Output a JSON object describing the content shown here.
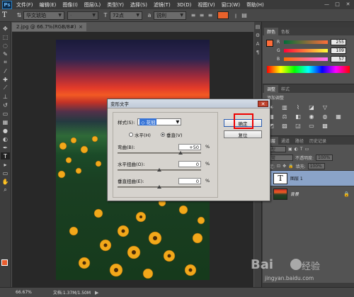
{
  "app": {
    "logo": "Ps"
  },
  "menu": [
    "文件(F)",
    "编辑(E)",
    "图像(I)",
    "图层(L)",
    "类型(Y)",
    "选择(S)",
    "滤镜(T)",
    "3D(D)",
    "视图(V)",
    "窗口(W)",
    "帮助(H)"
  ],
  "window_controls": [
    "—",
    "□",
    "✕"
  ],
  "options": {
    "font_family": "华文琥珀",
    "font_style": "-",
    "font_size": "72点",
    "aa_label": "a",
    "aa_method": "锐利",
    "text_color": "#e9622b"
  },
  "document": {
    "tab_title": "2.jpg @ 66.7%(RGB/8#)",
    "close_glyph": "×"
  },
  "panels": {
    "color": {
      "tabs": [
        "颜色",
        "色板"
      ],
      "r": {
        "label": "R",
        "value": "255"
      },
      "g": {
        "label": "G",
        "value": "109"
      },
      "b": {
        "label": "B",
        "value": "57"
      }
    },
    "adjustments": {
      "tabs": [
        "调整",
        "样式"
      ],
      "title": "添加调整"
    },
    "layers": {
      "tabs": [
        "图层",
        "通道",
        "路径",
        "历史记录"
      ],
      "kind": "类型",
      "blend_mode": "正常",
      "opacity_label": "不透明度:",
      "opacity": "100%",
      "lock_label": "锁定:",
      "fill_label": "填充:",
      "fill": "100%",
      "items": [
        {
          "name": "图层 1"
        },
        {
          "name": "背景"
        }
      ]
    }
  },
  "status": {
    "zoom": "66.67%",
    "doc_size": "文档:1.37M/1.50M"
  },
  "dialog": {
    "title": "变形文字",
    "style_label": "样式(S):",
    "style_value": "◇ 花冠",
    "orient_horizontal": "水平(H)",
    "orient_vertical": "垂直(V)",
    "orient_selected": "vertical",
    "bend": {
      "label": "弯曲(B):",
      "value": "+50",
      "unit": "%",
      "level": 50
    },
    "h_distort": {
      "label": "水平扭曲(O):",
      "value": "0",
      "unit": "%",
      "level": 0
    },
    "v_distort": {
      "label": "垂直扭曲(E):",
      "value": "0",
      "unit": "%",
      "level": 0
    },
    "ok_label": "确定",
    "reset_label": "复位",
    "close_glyph": "✕"
  },
  "watermark": {
    "brand": "Bai",
    "brand2": "经验",
    "url": "jingyan.baidu.com"
  }
}
